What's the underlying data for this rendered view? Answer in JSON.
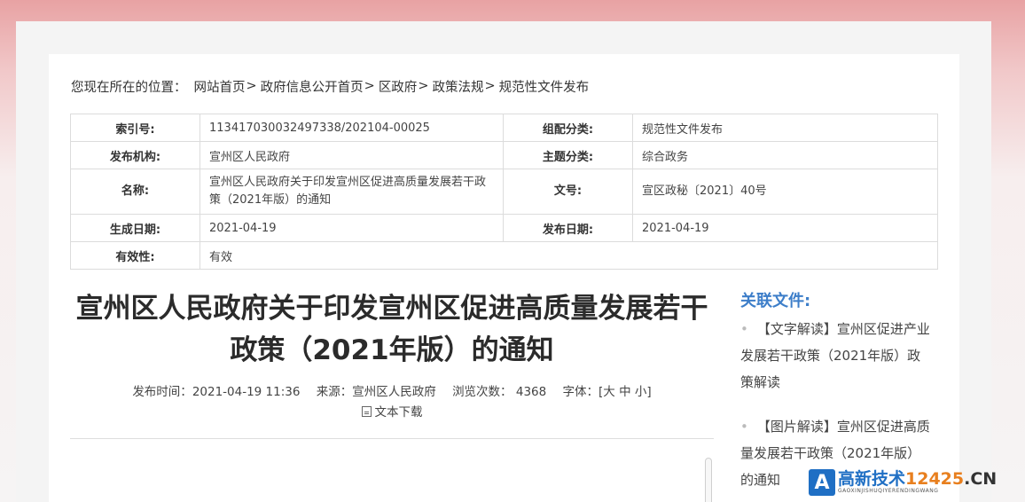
{
  "breadcrumb": {
    "lead": "您现在所在的位置：",
    "items": [
      "网站首页",
      "政府信息公开首页",
      "区政府",
      "政策法规",
      "规范性文件发布"
    ],
    "separators": [
      ">",
      " >",
      ">",
      ">"
    ]
  },
  "meta": {
    "index_label": "索引号:",
    "index_value": "113417030032497338/202104-00025",
    "category_label": "组配分类:",
    "category_value": "规范性文件发布",
    "publisher_label": "发布机构:",
    "publisher_value": "宣州区人民政府",
    "topic_label": "主题分类:",
    "topic_value": "综合政务",
    "name_label": "名称:",
    "name_value": "宣州区人民政府关于印发宣州区促进高质量发展若干政策（2021年版）的通知",
    "docno_label": "文号:",
    "docno_value": "宣区政秘〔2021〕40号",
    "created_label": "生成日期:",
    "created_value": "2021-04-19",
    "published_label": "发布日期:",
    "published_value": "2021-04-19",
    "validity_label": "有效性:",
    "validity_value": "有效"
  },
  "article": {
    "title": "宣州区人民政府关于印发宣州区促进高质量发展若干政策（2021年版）的通知",
    "time_label": "发布时间：",
    "time_value": "2021-04-19 11:36",
    "source_label": "来源：",
    "source_value": "宣州区人民政府",
    "views_label": "浏览次数：",
    "views_value": "4368",
    "font_label": "字体：",
    "font_open": "[",
    "font_large": "大",
    "font_medium": "中",
    "font_small": "小",
    "font_close": "]",
    "download_label": "文本下载"
  },
  "related": {
    "title": "关联文件:",
    "items": [
      "【文字解读】宣州区促进产业发展若干政策（2021年版）政策解读",
      "【图片解读】宣州区促进高质量发展若干政策（2021年版）的通知"
    ]
  },
  "watermark": {
    "main_a": "高新技术",
    "main_num": "12425",
    "main_cn": ".CN",
    "sub": "GAOXINJISHUQIYERENDINGWANG",
    "logo_letter": "A"
  },
  "colors": {
    "accent": "#3d7ec9",
    "top_band": "#e8a2a3"
  }
}
